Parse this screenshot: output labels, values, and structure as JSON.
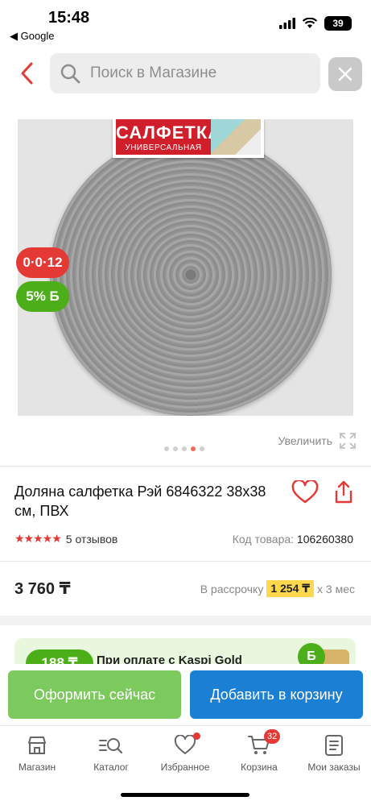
{
  "status_bar": {
    "time": "15:48",
    "back_app": "◀ Google",
    "battery": "39"
  },
  "search": {
    "placeholder": "Поиск в Магазине"
  },
  "product": {
    "package_title": "САЛФЕТКА",
    "package_subtitle": "УНИВЕРСАЛЬНАЯ",
    "installment_badge": "0·0·12",
    "bonus_badge": "5% Б",
    "zoom_label": "Увеличить",
    "gallery": {
      "count": 5,
      "active_index": 3
    },
    "title": "Доляна салфетка Рэй 6846322 38x38 см, ПВХ",
    "stars": "★★★★★",
    "reviews": "5 отзывов",
    "code_label": "Код товара:",
    "code": "106260380",
    "price": "3 760 ₸",
    "credit_prefix": "В рассрочку",
    "credit_amount": "1 254 ₸",
    "credit_suffix": "x 3 мес"
  },
  "promo": {
    "pill": "188 ₸",
    "text": "При оплате с Kaspi Gold",
    "coin": "Б"
  },
  "actions": {
    "buy_now": "Оформить сейчас",
    "add_to_cart": "Добавить в корзину"
  },
  "tabbar": {
    "items": [
      {
        "label": "Магазин"
      },
      {
        "label": "Каталог"
      },
      {
        "label": "Избранное"
      },
      {
        "label": "Корзина",
        "badge": "32"
      },
      {
        "label": "Мои заказы"
      }
    ]
  },
  "colors": {
    "accent_red": "#e53935",
    "green": "#4caf1a",
    "blue": "#1b7fd3",
    "yellow": "#ffd84d"
  }
}
